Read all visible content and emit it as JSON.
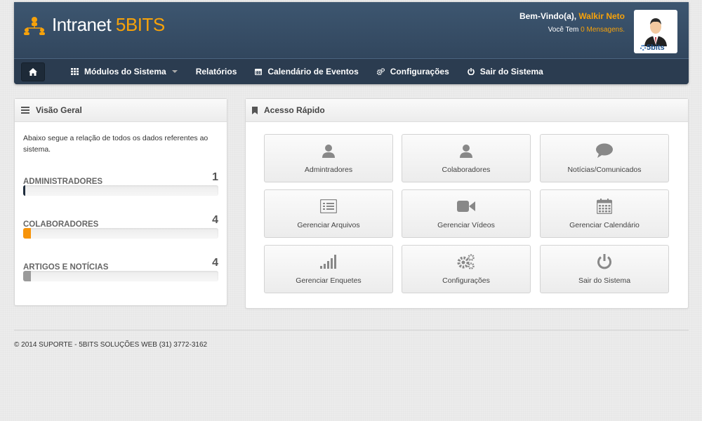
{
  "header": {
    "brand_name": "Intranet",
    "brand_accent": "5BITS",
    "welcome_prefix": "Bem-Vindo(a),",
    "user_name": "Walkir Neto",
    "messages_prefix": "Você Tem",
    "messages_link": "0 Mensagens.",
    "avatar_brand": "5bits"
  },
  "nav": {
    "items": [
      {
        "label": "Módulos do Sistema",
        "icon": "grid-icon"
      },
      {
        "label": "Relatórios"
      },
      {
        "label": "Calendário de Eventos",
        "icon": "calendar-icon"
      },
      {
        "label": "Configurações",
        "icon": "gears-icon"
      },
      {
        "label": "Sair do Sistema",
        "icon": "power-icon"
      }
    ]
  },
  "overview": {
    "title": "Visão Geral",
    "description": "Abaixo segue a relação de todos os dados referentes ao sistema.",
    "stats": [
      {
        "label": "ADMINISTRADORES",
        "count": "1",
        "fill_percent": 1,
        "color": "#1f2d3d"
      },
      {
        "label": "COLABORADORES",
        "count": "4",
        "fill_percent": 4,
        "color": "#f7940a"
      },
      {
        "label": "ARTIGOS E NOTÍCIAS",
        "count": "4",
        "fill_percent": 4,
        "color": "#9a9a9a"
      }
    ]
  },
  "quick": {
    "title": "Acesso Rápido",
    "tiles": [
      {
        "label": "Admintradores",
        "icon": "user-icon"
      },
      {
        "label": "Colaboradores",
        "icon": "user-icon"
      },
      {
        "label": "Notícias/Comunicados",
        "icon": "comment-icon"
      },
      {
        "label": "Gerenciar Arquivos",
        "icon": "list-icon"
      },
      {
        "label": "Gerenciar Vídeos",
        "icon": "video-icon"
      },
      {
        "label": "Gerenciar Calendário",
        "icon": "calendar-icon"
      },
      {
        "label": "Gerenciar Enquetes",
        "icon": "signal-icon"
      },
      {
        "label": "Configurações",
        "icon": "gears-icon"
      },
      {
        "label": "Sair do Sistema",
        "icon": "power-icon"
      }
    ]
  },
  "footer": {
    "text": "© 2014 SUPORTE - 5BITS SOLUÇÕES WEB (31) 3772-3162"
  },
  "colors": {
    "accent": "#f7a20a",
    "header_bg": "#34495f",
    "nav_bg": "#2b3c50",
    "icon_gray": "#888888"
  }
}
